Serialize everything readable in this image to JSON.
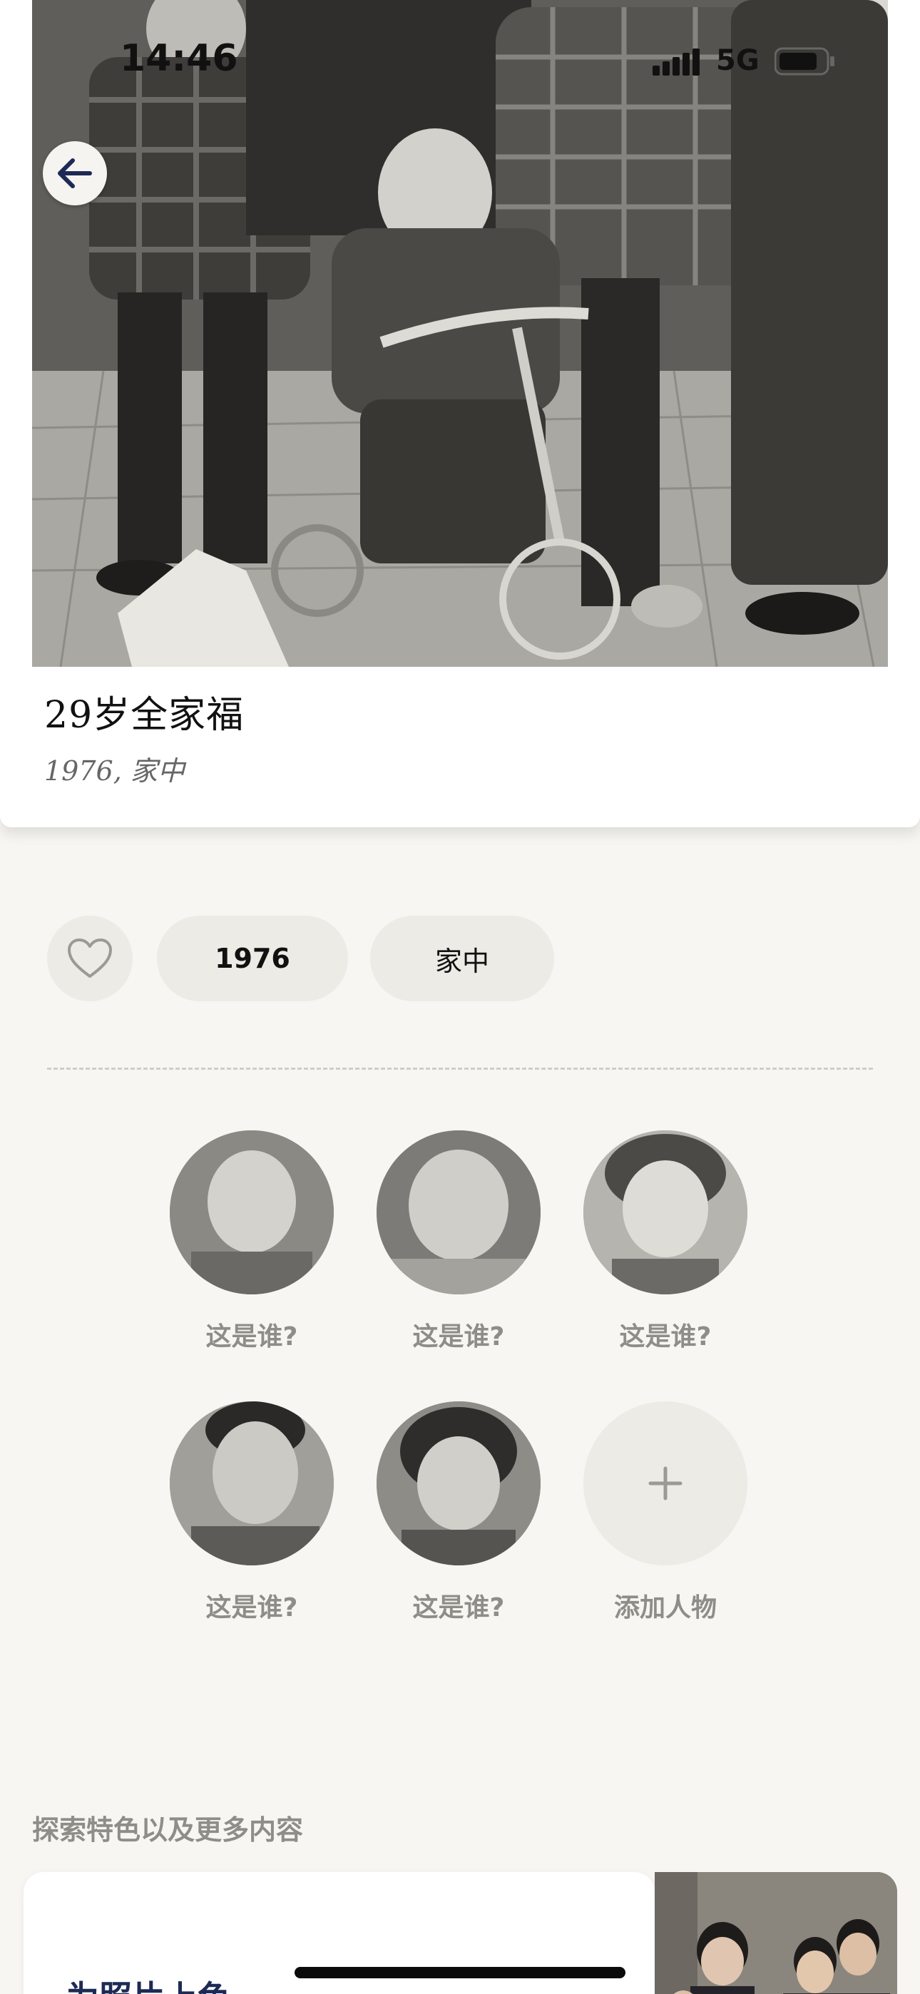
{
  "status_bar": {
    "time": "14:46",
    "network": "5G"
  },
  "photo": {
    "title": "29岁全家福",
    "meta": "1976, 家中"
  },
  "tags": {
    "year": "1976",
    "place": "家中"
  },
  "people": {
    "unknown_label": "这是谁?",
    "add_label": "添加人物"
  },
  "explore": {
    "section_title": "探索特色以及更多内容",
    "feature_title": "为照片上色"
  },
  "colors": {
    "background": "#f7f6f2",
    "chip": "#ecebe6",
    "muted_text": "#8e8d88",
    "feature_title": "#1d2a55"
  },
  "icons": [
    "back-arrow-icon",
    "heart-icon",
    "plus-icon",
    "signal-icon",
    "battery-icon"
  ]
}
